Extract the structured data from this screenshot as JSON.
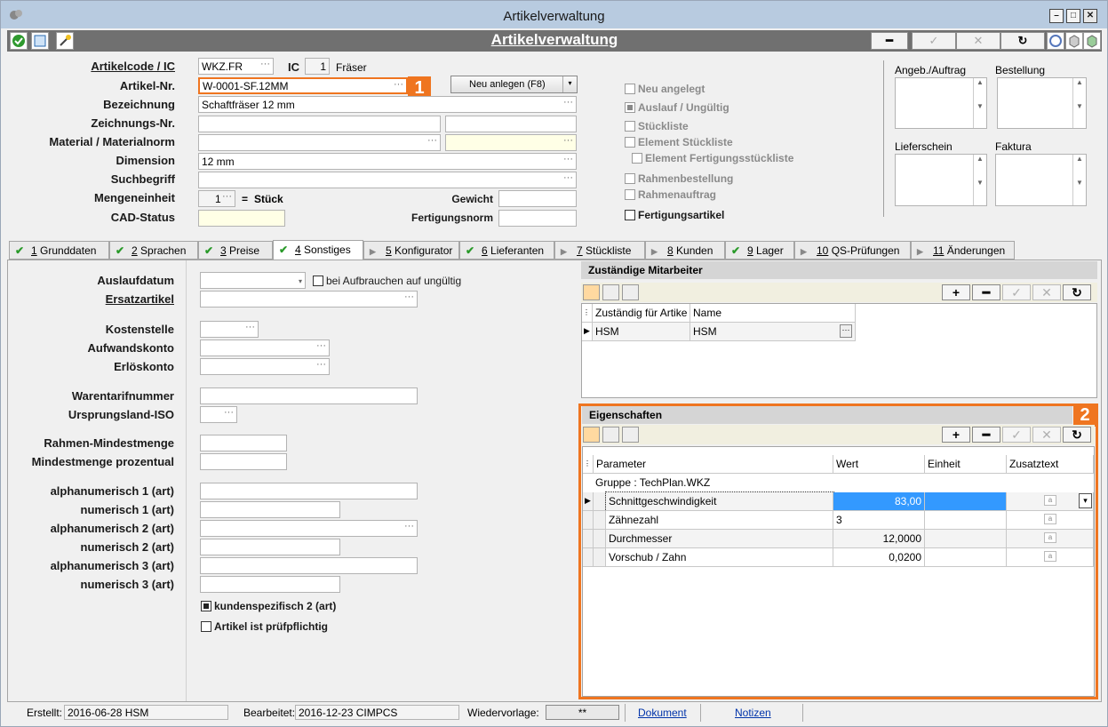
{
  "window": {
    "title": "Artikelverwaltung",
    "header": "Artikelverwaltung"
  },
  "header": {
    "artikelcode_label": "Artikelcode / IC",
    "artikelcode": "WKZ.FR",
    "ic_label": "IC",
    "ic_value": "1",
    "ic_name": "Fräser",
    "artikelnr_label": "Artikel-Nr.",
    "artikelnr": "W-0001-SF.12MM",
    "new_button": "Neu anlegen (F8)",
    "bezeichnung_label": "Bezeichnung",
    "bezeichnung": "Schaftfräser 12 mm",
    "zeichnung_label": "Zeichnungs-Nr.",
    "material_label": "Material / Materialnorm",
    "dimension_label": "Dimension",
    "dimension": "12 mm",
    "suchbegriff_label": "Suchbegriff",
    "mengeneinheit_label": "Mengeneinheit",
    "menge_value": "1",
    "menge_eq": "=",
    "menge_unit": "Stück",
    "cad_label": "CAD-Status",
    "gewicht_label": "Gewicht",
    "fertigungsnorm_label": "Fertigungsnorm"
  },
  "checks": {
    "neu": "Neu angelegt",
    "auslauf": "Auslauf / Ungültig",
    "stueckliste": "Stückliste",
    "element_st": "Element Stückliste",
    "element_fst": "Element Fertigungsstückliste",
    "rahmenbest": "Rahmenbestellung",
    "rahmenauftrag": "Rahmenauftrag",
    "fertigungsartikel": "Fertigungsartikel"
  },
  "notes": {
    "angeb": "Angeb./Auftrag",
    "bestellung": "Bestellung",
    "lieferschein": "Lieferschein",
    "faktura": "Faktura"
  },
  "tabs": [
    {
      "n": "1",
      "label": "Grunddaten"
    },
    {
      "n": "2",
      "label": "Sprachen"
    },
    {
      "n": "3",
      "label": "Preise"
    },
    {
      "n": "4",
      "label": "Sonstiges"
    },
    {
      "n": "5",
      "label": "Konfigurator"
    },
    {
      "n": "6",
      "label": "Lieferanten"
    },
    {
      "n": "7",
      "label": "Stückliste"
    },
    {
      "n": "8",
      "label": "Kunden"
    },
    {
      "n": "9",
      "label": "Lager"
    },
    {
      "n": "10",
      "label": "QS-Prüfungen"
    },
    {
      "n": "11",
      "label": "Änderungen"
    }
  ],
  "left": {
    "auslaufdatum": "Auslaufdatum",
    "aufbrauchen": "bei Aufbrauchen auf ungültig",
    "ersatzartikel": "Ersatzartikel",
    "kostenstelle": "Kostenstelle",
    "aufwandskonto": "Aufwandskonto",
    "erloeskonto": "Erlöskonto",
    "warentarif": "Warentarifnummer",
    "ursprungsland": "Ursprungsland-ISO",
    "rahmenmin": "Rahmen-Mindestmenge",
    "mindestproz": "Mindestmenge prozentual",
    "alpha1": "alphanumerisch 1 (art)",
    "num1": "numerisch 1 (art)",
    "alpha2": "alphanumerisch 2 (art)",
    "num2": "numerisch 2 (art)",
    "alpha3": "alphanumerisch 3 (art)",
    "num3": "numerisch 3 (art)",
    "kundenspez": "kundenspezifisch 2 (art)",
    "pruefpflichtig": "Artikel ist prüfpflichtig"
  },
  "mitarbeiter": {
    "title": "Zuständige Mitarbeiter",
    "col1": "Zuständig für Artike",
    "col2": "Name",
    "r1c1": "HSM",
    "r1c2": "HSM"
  },
  "eigenschaften": {
    "title": "Eigenschaften",
    "col_param": "Parameter",
    "col_wert": "Wert",
    "col_einheit": "Einheit",
    "col_zusatz": "Zusatztext",
    "group": "Gruppe : TechPlan.WKZ",
    "rows": [
      {
        "param": "Schnittgeschwindigkeit",
        "wert": "83,00"
      },
      {
        "param": "Zähnezahl",
        "wert": "3"
      },
      {
        "param": "Durchmesser",
        "wert": "12,0000"
      },
      {
        "param": "Vorschub / Zahn",
        "wert": "0,0200"
      }
    ]
  },
  "badges": {
    "b1": "1",
    "b2": "2"
  },
  "status": {
    "erstellt_label": "Erstellt:",
    "erstellt": "2016-06-28  HSM",
    "bearbeitet_label": "Bearbeitet:",
    "bearbeitet": "2016-12-23  CIMPCS",
    "wiedervorlage_label": "Wiedervorlage:",
    "wiedervorlage": "**",
    "dokument": "Dokument",
    "notizen": "Notizen"
  },
  "colors": {
    "accent": "#ef7520",
    "selection": "#3399ff",
    "header_bar": "#707070"
  }
}
